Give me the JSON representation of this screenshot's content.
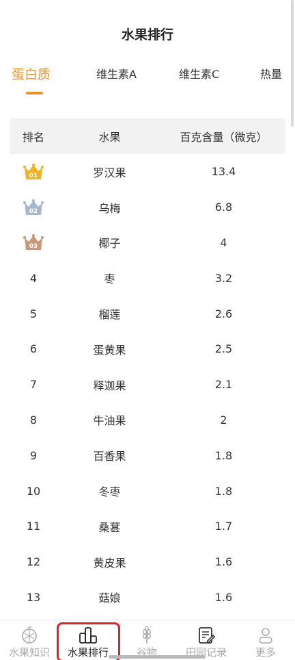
{
  "page": {
    "title": "水果排行"
  },
  "tabs": [
    {
      "label": "蛋白质",
      "active": true
    },
    {
      "label": "维生素A",
      "active": false
    },
    {
      "label": "维生素C",
      "active": false
    },
    {
      "label": "热量",
      "active": false
    }
  ],
  "table": {
    "headers": [
      "排名",
      "水果",
      "百克含量（微克）"
    ],
    "rows": [
      {
        "rank": "01",
        "medal": "gold-crown-icon",
        "fruit": "罗汉果",
        "value": "13.4"
      },
      {
        "rank": "02",
        "medal": "silver-crown-icon",
        "fruit": "乌梅",
        "value": "6.8"
      },
      {
        "rank": "03",
        "medal": "bronze-crown-icon",
        "fruit": "椰子",
        "value": "4"
      },
      {
        "rank": "4",
        "fruit": "枣",
        "value": "3.2"
      },
      {
        "rank": "5",
        "fruit": "榴莲",
        "value": "2.6"
      },
      {
        "rank": "6",
        "fruit": "蛋黄果",
        "value": "2.5"
      },
      {
        "rank": "7",
        "fruit": "释迦果",
        "value": "2.1"
      },
      {
        "rank": "8",
        "fruit": "牛油果",
        "value": "2"
      },
      {
        "rank": "9",
        "fruit": "百香果",
        "value": "1.8"
      },
      {
        "rank": "10",
        "fruit": "冬枣",
        "value": "1.8"
      },
      {
        "rank": "11",
        "fruit": "桑葚",
        "value": "1.7"
      },
      {
        "rank": "12",
        "fruit": "黄皮果",
        "value": "1.6"
      },
      {
        "rank": "13",
        "fruit": "菇娘",
        "value": "1.6"
      }
    ]
  },
  "bottom_nav": [
    {
      "label": "水果知识",
      "icon": "fruit-knowledge-icon",
      "active": false
    },
    {
      "label": "水果排行",
      "icon": "ranking-icon",
      "active": true
    },
    {
      "label": "谷物",
      "icon": "wheat-icon",
      "active": false
    },
    {
      "label": "田园记录",
      "icon": "note-edit-icon",
      "active": false
    },
    {
      "label": "更多",
      "icon": "user-more-icon",
      "active": false
    }
  ],
  "colors": {
    "accent": "#e8922e",
    "gold": "#f0b21f",
    "silver": "#a8b8cc",
    "bronze": "#c99878",
    "highlight": "#e0202a"
  }
}
